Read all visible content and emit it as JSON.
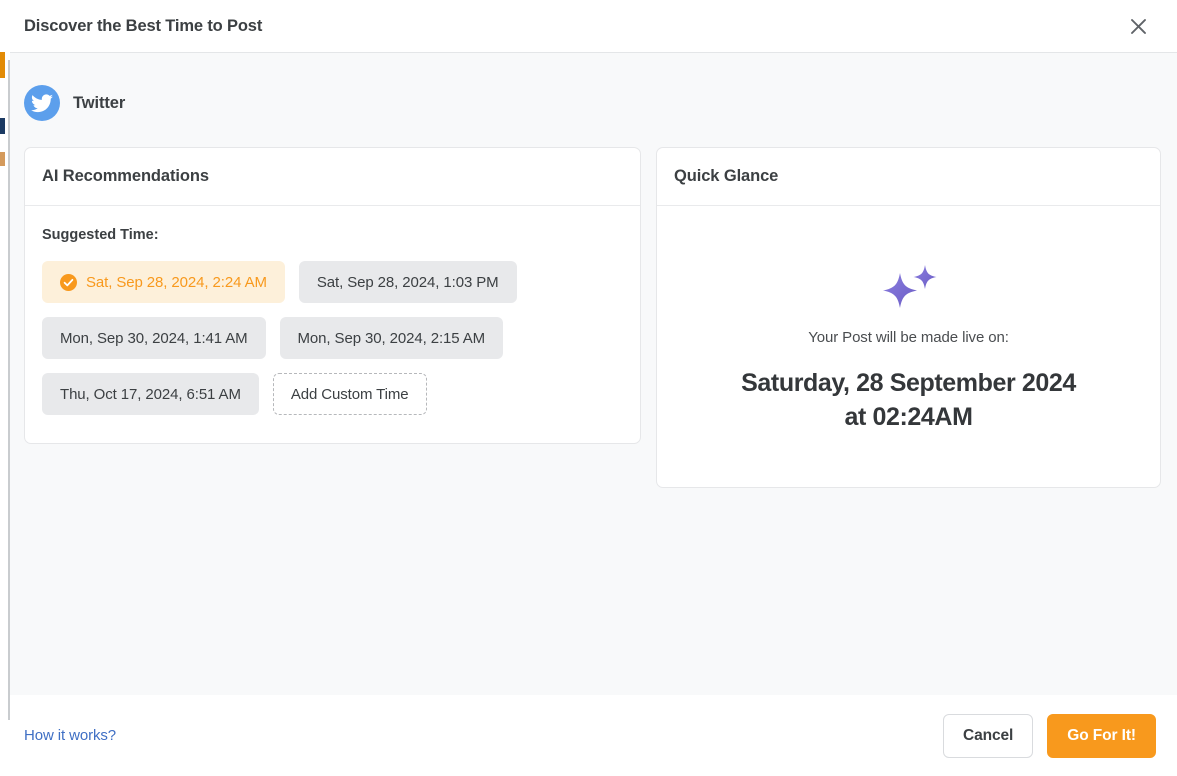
{
  "header": {
    "title": "Discover the Best Time to Post",
    "close_icon": "close-icon"
  },
  "channel": {
    "name": "Twitter",
    "avatar_icon": "twitter-bird-icon",
    "avatar_color": "#5c9fec"
  },
  "recommendations": {
    "panel_title": "AI Recommendations",
    "suggested_label": "Suggested Time:",
    "selected_icon": "check-circle-icon",
    "selected_color": "#f8991d",
    "chips": [
      {
        "label": "Sat, Sep 28, 2024, 2:24 AM",
        "selected": true
      },
      {
        "label": "Sat, Sep 28, 2024, 1:03 PM",
        "selected": false
      },
      {
        "label": "Mon, Sep 30, 2024, 1:41 AM",
        "selected": false
      },
      {
        "label": "Mon, Sep 30, 2024, 2:15 AM",
        "selected": false
      },
      {
        "label": "Thu, Oct 17, 2024, 6:51 AM",
        "selected": false
      }
    ],
    "add_custom_label": "Add Custom Time"
  },
  "quick_glance": {
    "panel_title": "Quick Glance",
    "sparkle_icon": "sparkles-icon",
    "sparkle_color": "#7b6ed6",
    "subtitle": "Your Post will be made live on:",
    "date_line": "Saturday, 28 September 2024",
    "time_line": "at 02:24AM"
  },
  "footer": {
    "how_it_works_label": "How it works?",
    "cancel_label": "Cancel",
    "go_label": "Go For It!",
    "go_color": "#f8991d",
    "link_color": "#3f6fc4"
  }
}
